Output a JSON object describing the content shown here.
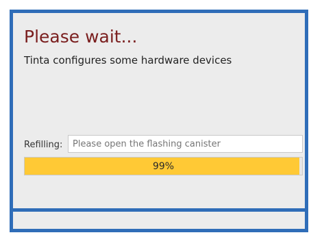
{
  "dialog": {
    "title": "Please wait...",
    "subtitle": "Tinta configures some hardware devices"
  },
  "refilling": {
    "label": "Refilling:",
    "value": "",
    "placeholder": "Please open the flashing canister"
  },
  "progress": {
    "value": 99,
    "text": "99%"
  },
  "colors": {
    "border": "#2f6db8",
    "title": "#7a1e1e",
    "panel_background": "#ececec",
    "progress_fill": "#ffc935"
  }
}
